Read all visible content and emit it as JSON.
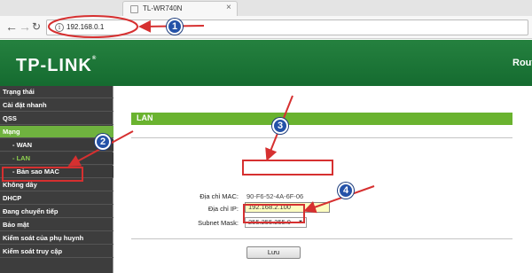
{
  "browser": {
    "tab_title": "TL-WR740N",
    "tab_close": "×",
    "back_glyph": "←",
    "forward_glyph": "→",
    "reload_glyph": "↻",
    "info_glyph": "i",
    "url": "192.168.0.1"
  },
  "header": {
    "logo": "TP-LINK",
    "logo_tm": "®",
    "right_text": "Rout"
  },
  "sidebar": {
    "items": [
      {
        "label": "Trạng thái"
      },
      {
        "label": "Cài đặt nhanh"
      },
      {
        "label": "QSS"
      },
      {
        "label": "Mạng"
      },
      {
        "label": "- WAN"
      },
      {
        "label": "- LAN"
      },
      {
        "label": "- Bản sao MAC"
      },
      {
        "label": "Không dây"
      },
      {
        "label": "DHCP"
      },
      {
        "label": "Đang chuyển tiếp"
      },
      {
        "label": "Bảo mật"
      },
      {
        "label": "Kiểm soát của phụ huynh"
      },
      {
        "label": "Kiểm soát truy cập"
      }
    ]
  },
  "main": {
    "section_title": "LAN",
    "mac_label": "Địa chỉ MAC:",
    "mac_value": "90-F6-52-4A-6F-06",
    "ip_label": "Địa chỉ IP:",
    "ip_value": "192.168.2.100",
    "mask_label": "Subnet Mask:",
    "mask_value": "255.255.255.0",
    "mask_arrow": "▼",
    "save_label": "Lưu"
  },
  "annotations": {
    "steps": [
      "1",
      "2",
      "3",
      "4"
    ],
    "color": "#d63030",
    "badge_color": "#2452a8"
  },
  "colors": {
    "brand_green": "#1f7a3c",
    "active_green": "#6fb23f",
    "sidebar_bg": "#3d3d3d",
    "ip_field_bg": "#fcfcc0"
  }
}
